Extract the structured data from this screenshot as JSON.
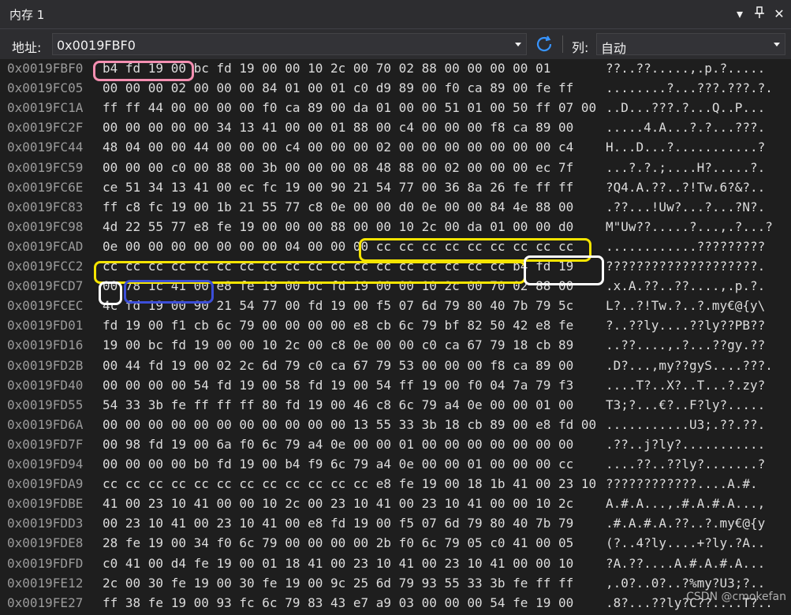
{
  "window": {
    "title": "内存 1"
  },
  "toolbar": {
    "address_label": "地址:",
    "address_value": "0x0019FBF0",
    "column_label": "列:",
    "column_value": "自动"
  },
  "highlights": {
    "pink": "#f48fb1",
    "yellow": "#f5e400",
    "white": "#ffffff",
    "blue": "#3c4ed8"
  },
  "rows": [
    {
      "addr": "0x0019FBF0",
      "hex": "b4 fd 19 00 bc fd 19 00 00 10 2c 00 70 02 88 00 00 00 00 01",
      "ascii": "??..??.....,.p.?....."
    },
    {
      "addr": "0x0019FC05",
      "hex": "00 00 00 02 00 00 00 84 01 00 01 c0 d9 89 00 f0 ca 89 00 fe ff",
      "ascii": "........?...???.???.?."
    },
    {
      "addr": "0x0019FC1A",
      "hex": "ff ff 44 00 00 00 00 f0 ca 89 00 da 01 00 00 51 01 00 50 ff 07 00",
      "ascii": "..D...???.?...Q..P..."
    },
    {
      "addr": "0x0019FC2F",
      "hex": "00 00 00 00 00 34 13 41 00 00 01 88 00 c4 00 00 00 f8 ca 89 00",
      "ascii": ".....4.A...?.?...???."
    },
    {
      "addr": "0x0019FC44",
      "hex": "48 04 00 00 44 00 00 00 c4 00 00 00 02 00 00 00 00 00 00 00 c4",
      "ascii": "H...D...?...........?"
    },
    {
      "addr": "0x0019FC59",
      "hex": "00 00 00 c0 00 88 00 3b 00 00 00 08 48 88 00 02 00 00 00 ec 7f",
      "ascii": "...?.?.;....H?.....?."
    },
    {
      "addr": "0x0019FC6E",
      "hex": "ce 51 34 13 41 00 ec fc 19 00 90 21 54 77 00 36 8a 26 fe ff ff",
      "ascii": "?Q4.A.??..?!Tw.6?&?.."
    },
    {
      "addr": "0x0019FC83",
      "hex": "ff c8 fc 19 00 1b 21 55 77 c8 0e 00 00 d0 0e 00 00 84 4e 88 00",
      "ascii": ".??...!Uw?...?...?N?."
    },
    {
      "addr": "0x0019FC98",
      "hex": "4d 22 55 77 e8 fe 19 00 00 00 88 00 00 10 2c 00 da 01 00 00 d0",
      "ascii": "M\"Uw??.....?...,.?...?"
    },
    {
      "addr": "0x0019FCAD",
      "hex": "0e 00 00 00 00 00 00 00 04 00 00 00 cc cc cc cc cc cc cc cc cc",
      "ascii": "............?????????"
    },
    {
      "addr": "0x0019FCC2",
      "hex": "cc cc cc cc cc cc cc cc cc cc cc cc cc cc cc cc cc cc b4 fd 19",
      "ascii": "????????????????????."
    },
    {
      "addr": "0x0019FCD7",
      "hex": "00 78 1c 41 00 e8 fe 19 00 bc fd 19 00 00 10 2c 00 70 02 88 00",
      "ascii": ".x.A.??..??....,.p.?."
    },
    {
      "addr": "0x0019FCEC",
      "hex": "4c fd 19 00 90 21 54 77 00 fd 19 00 f5 07 6d 79 80 40 7b 79 5c",
      "ascii": "L?..?!Tw.?..?.my€@{y\\"
    },
    {
      "addr": "0x0019FD01",
      "hex": "fd 19 00 f1 cb 6c 79 00 00 00 00 e8 cb 6c 79 bf 82 50 42 e8 fe",
      "ascii": "?..??ly....??ly??PB??"
    },
    {
      "addr": "0x0019FD16",
      "hex": "19 00 bc fd 19 00 00 10 2c 00 c8 0e 00 00 c0 ca 67 79 18 cb 89",
      "ascii": "..??....,.?...??gy.??"
    },
    {
      "addr": "0x0019FD2B",
      "hex": "00 44 fd 19 00 02 2c 6d 79 c0 ca 67 79 53 00 00 00 f8 ca 89 00",
      "ascii": ".D?...,my??gyS....???."
    },
    {
      "addr": "0x0019FD40",
      "hex": "00 00 00 00 54 fd 19 00 58 fd 19 00 54 ff 19 00 f0 04 7a 79 f3",
      "ascii": "....T?..X?..T...?.zy?"
    },
    {
      "addr": "0x0019FD55",
      "hex": "54 33 3b fe ff ff ff 80 fd 19 00 46 c8 6c 79 a4 0e 00 00 01 00",
      "ascii": "T3;?...€?..F?ly?....."
    },
    {
      "addr": "0x0019FD6A",
      "hex": "00 00 00 00 00 00 00 00 00 00 00 13 55 33 3b 18 cb 89 00 e8 fd 00",
      "ascii": "...........U3;.??.??."
    },
    {
      "addr": "0x0019FD7F",
      "hex": "00 98 fd 19 00 6a f0 6c 79 a4 0e 00 00 01 00 00 00 00 00 00 00",
      "ascii": ".??..j?ly?..........."
    },
    {
      "addr": "0x0019FD94",
      "hex": "00 00 00 00 b0 fd 19 00 b4 f9 6c 79 a4 0e 00 00 01 00 00 00 cc",
      "ascii": "....??..??ly?.......?"
    },
    {
      "addr": "0x0019FDA9",
      "hex": "cc cc cc cc cc cc cc cc cc cc cc cc e8 fe 19 00 18 1b 41 00 23 10",
      "ascii": "????????????....A.#."
    },
    {
      "addr": "0x0019FDBE",
      "hex": "41 00 23 10 41 00 00 10 2c 00 23 10 41 00 23 10 41 00 00 10 2c",
      "ascii": "A.#.A...,.#.A.#.A...,"
    },
    {
      "addr": "0x0019FDD3",
      "hex": "00 23 10 41 00 23 10 41 00 e8 fd 19 00 f5 07 6d 79 80 40 7b 79",
      "ascii": ".#.A.#.A.??..?.my€@{y"
    },
    {
      "addr": "0x0019FDE8",
      "hex": "28 fe 19 00 34 f0 6c 79 00 00 00 00 2b f0 6c 79 05 c0 41 00 05",
      "ascii": "(?..4?ly....+?ly.?A.."
    },
    {
      "addr": "0x0019FDFD",
      "hex": "c0 41 00 d4 fe 19 00 01 18 41 00 23 10 41 00 23 10 41 00 00 10",
      "ascii": "?A.??....A.#.A.#.A..."
    },
    {
      "addr": "0x0019FE12",
      "hex": "2c 00 30 fe 19 00 30 fe 19 00 9c 25 6d 79 93 55 33 3b fe ff ff",
      "ascii": ",.0?..0?..?%my?U3;?.."
    },
    {
      "addr": "0x0019FE27",
      "hex": "ff 38 fe 19 00 93 fc 6c 79 83 43 e7 a9 03 00 00 00 54 fe 19 00",
      "ascii": ".8?...??ly?C??....T?.."
    }
  ],
  "watermark": "CSDN @cmokefan"
}
